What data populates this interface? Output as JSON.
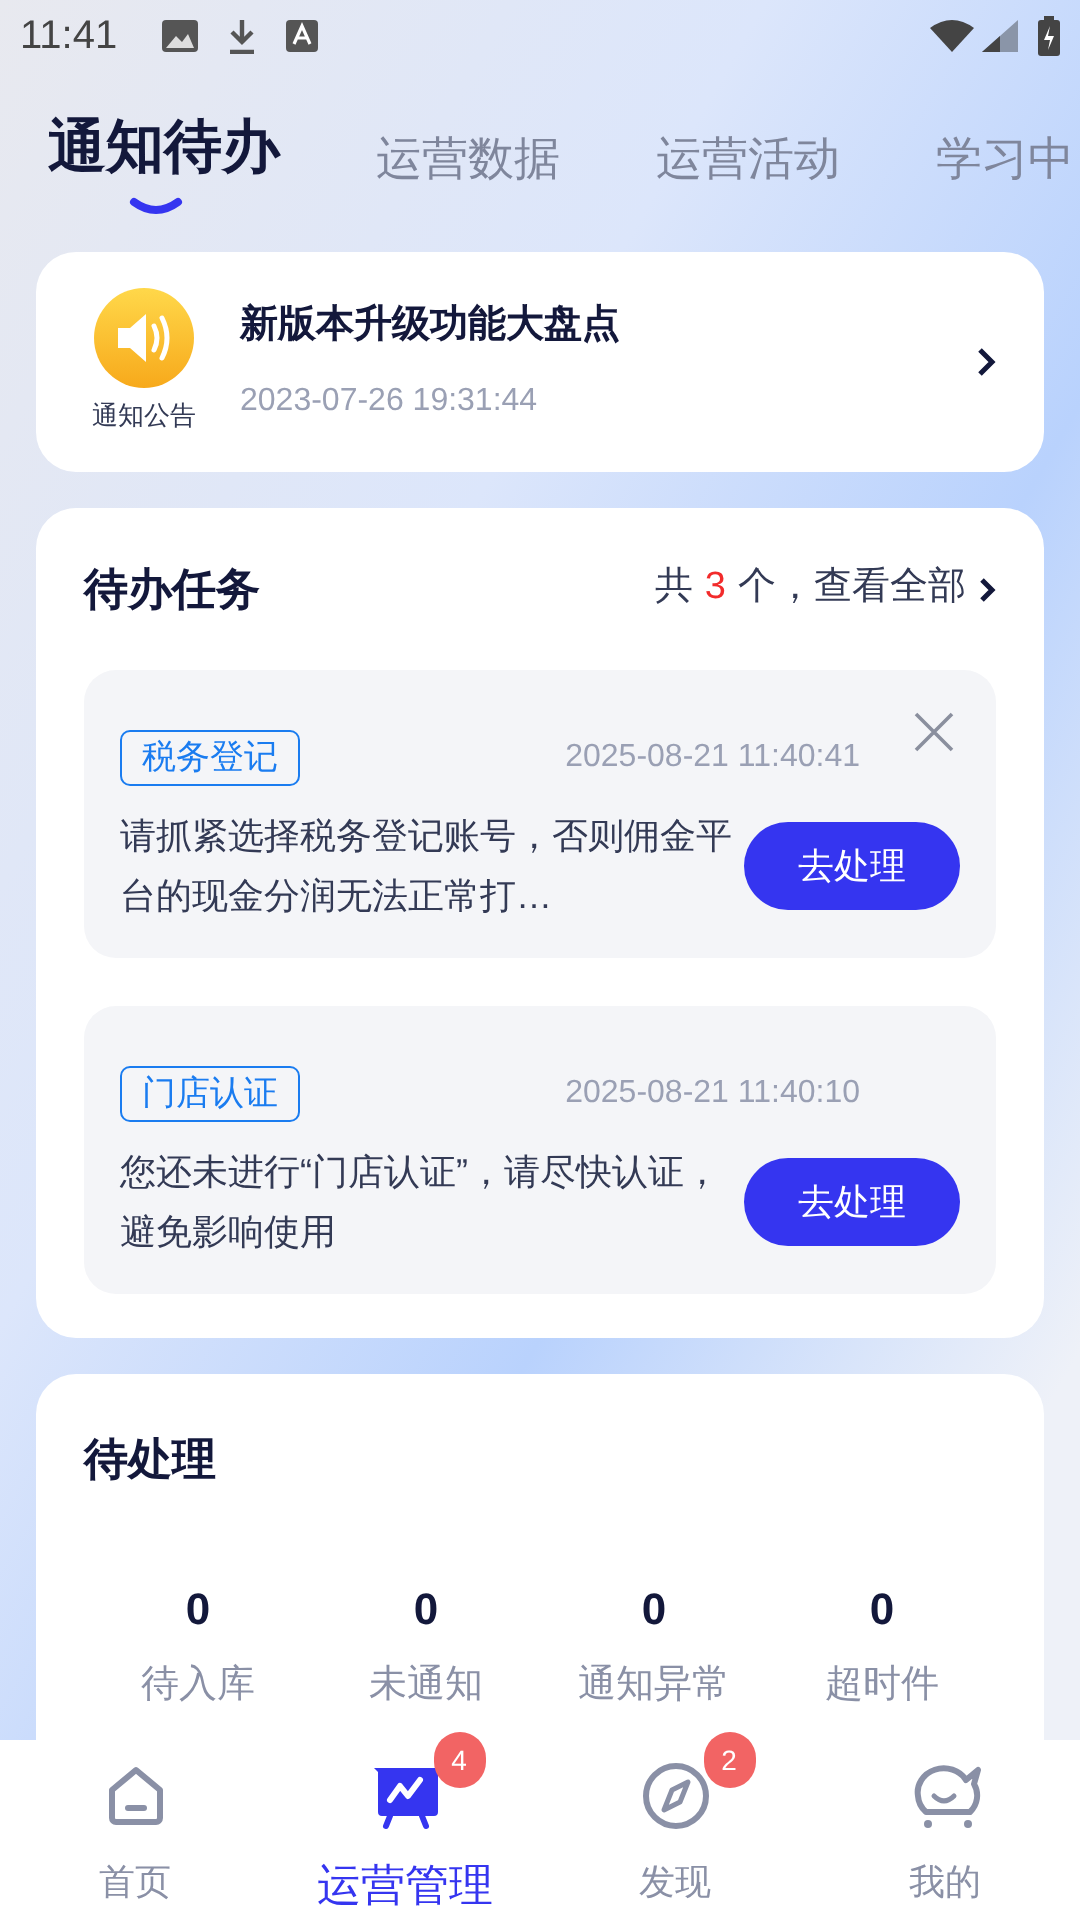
{
  "status_bar": {
    "time": "11:41"
  },
  "tabs": [
    {
      "label": "通知待办",
      "selected": true
    },
    {
      "label": "运营数据",
      "selected": false
    },
    {
      "label": "运营活动",
      "selected": false
    },
    {
      "label": "学习中",
      "selected": false
    }
  ],
  "announcement": {
    "caption": "通知公告",
    "title": "新版本升级功能大盘点",
    "time": "2023-07-26 19:31:44"
  },
  "tasks": {
    "title": "待办任务",
    "summary_prefix": "共",
    "count": "3",
    "summary_suffix": "个，查看全部",
    "items": [
      {
        "tag": "税务登记",
        "time": "2025-08-21 11:40:41",
        "message": "请抓紧选择税务登记账号，否则佣金平台的现金分润无法正常打…",
        "closable": true,
        "action": "去处理"
      },
      {
        "tag": "门店认证",
        "time": "2025-08-21 11:40:10",
        "message": "您还未进行“门店认证”，请尽快认证，避免影响使用",
        "closable": false,
        "action": "去处理"
      }
    ]
  },
  "pending": {
    "title": "待处理",
    "stats": [
      {
        "value": "0",
        "label": "待入库"
      },
      {
        "value": "0",
        "label": "未通知"
      },
      {
        "value": "0",
        "label": "通知异常"
      },
      {
        "value": "0",
        "label": "超时件"
      }
    ]
  },
  "nav": [
    {
      "kind": "home",
      "label": "首页",
      "selected": false
    },
    {
      "kind": "ops",
      "label": "运营管理",
      "selected": true,
      "badge": "4"
    },
    {
      "kind": "discover",
      "label": "发现",
      "selected": false,
      "badge": "2"
    },
    {
      "kind": "me",
      "label": "我的",
      "selected": false
    }
  ]
}
